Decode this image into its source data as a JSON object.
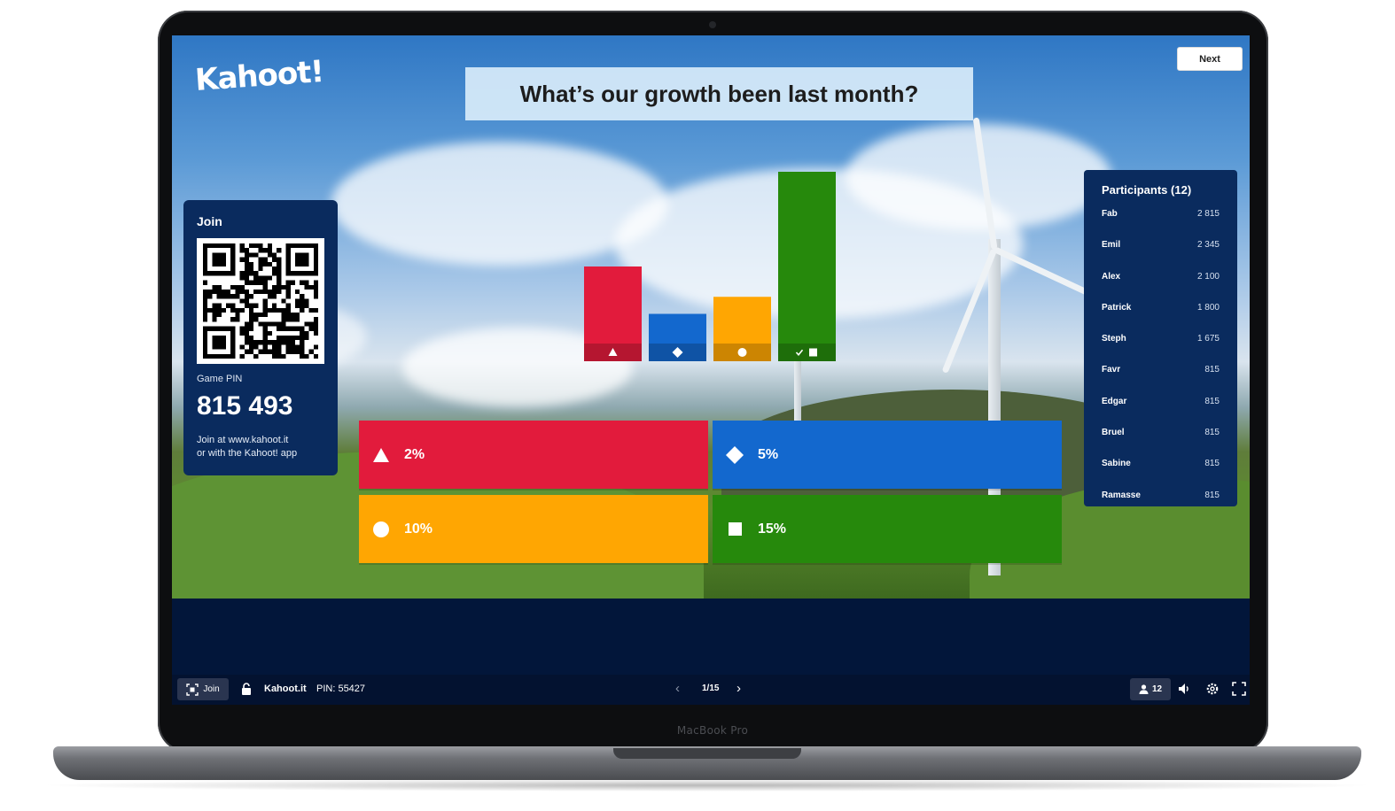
{
  "device": {
    "model_label": "MacBook Pro"
  },
  "app": {
    "logo": "Kahoot!"
  },
  "header": {
    "question": "What’s our growth been last month?",
    "next_label": "Next"
  },
  "join_panel": {
    "title": "Join",
    "pin_label": "Game PIN",
    "pin_value": "815 493",
    "instructions_line1": "Join at www.kahoot.it",
    "instructions_line2": "or with the Kahoot! app"
  },
  "participants": {
    "title": "Participants (12)",
    "rows": [
      {
        "name": "Fab",
        "score": "2 815"
      },
      {
        "name": "Emil",
        "score": "2 345"
      },
      {
        "name": "Alex",
        "score": "2 100"
      },
      {
        "name": "Patrick",
        "score": "1 800"
      },
      {
        "name": "Steph",
        "score": "1 675"
      },
      {
        "name": "Favr",
        "score": "815"
      },
      {
        "name": "Edgar",
        "score": "815"
      },
      {
        "name": "Bruel",
        "score": "815"
      },
      {
        "name": "Sabine",
        "score": "815"
      },
      {
        "name": "Ramasse",
        "score": "815"
      }
    ]
  },
  "results_chart": {
    "bars": [
      {
        "shape": "triangle-icon",
        "color": "#e21b3c",
        "level": 0.5,
        "correct": false
      },
      {
        "shape": "diamond-icon",
        "color": "#1368ce",
        "level": 0.25,
        "correct": false
      },
      {
        "shape": "circle-icon",
        "color": "#ffa602",
        "level": 0.34,
        "correct": false
      },
      {
        "shape": "square-icon",
        "color": "#26890c",
        "level": 1.0,
        "correct": true
      }
    ]
  },
  "answers": [
    {
      "label": "2%",
      "shape": "triangle-icon",
      "color": "#e21b3c"
    },
    {
      "label": "5%",
      "shape": "diamond-icon",
      "color": "#1368ce"
    },
    {
      "label": "10%",
      "shape": "circle-icon",
      "color": "#ffa602"
    },
    {
      "label": "15%",
      "shape": "square-icon",
      "color": "#26890c"
    }
  ],
  "control_bar": {
    "join_label": "Join",
    "url": "Kahoot.it",
    "pin": "PIN: 55427",
    "page": "1/15",
    "players_count": "12",
    "icons": [
      "qr-icon",
      "lock-icon",
      "chevron-left-icon",
      "chevron-right-icon",
      "user-icon",
      "volume-icon",
      "settings-icon",
      "fullscreen-icon"
    ]
  }
}
